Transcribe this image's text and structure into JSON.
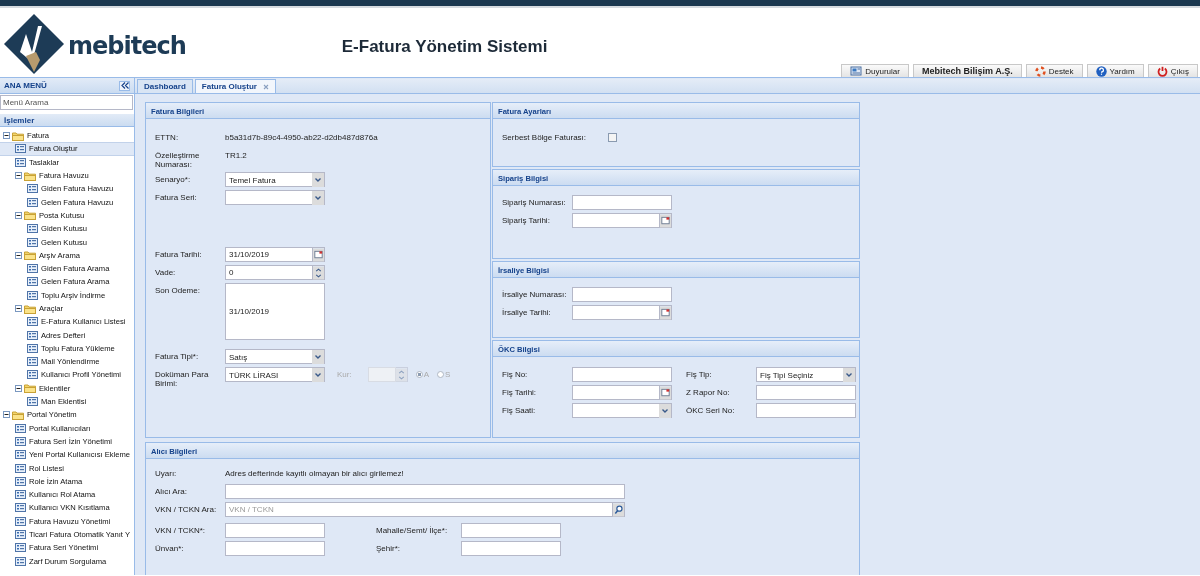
{
  "header": {
    "logo_text": "mebitech",
    "title": "E-Fatura Yönetim Sistemi",
    "buttons": [
      {
        "label": "Duyurular"
      },
      {
        "label": "Mebitech Bilişim A.Ş."
      },
      {
        "label": "Destek"
      },
      {
        "label": "Yardım"
      },
      {
        "label": "Çıkış"
      }
    ]
  },
  "sidebar": {
    "title": "ANA MENÜ",
    "search": {
      "placeholder": "Menü Arama"
    },
    "section": "İşlemler",
    "tree": [
      {
        "label": "Fatura",
        "kind": "folder",
        "expanded": true,
        "selected": false,
        "children": [
          {
            "label": "Fatura Oluştur",
            "kind": "page",
            "selected": true
          },
          {
            "label": "Taslaklar",
            "kind": "page",
            "selected": false
          },
          {
            "label": "Fatura Havuzu",
            "kind": "folder",
            "expanded": true,
            "selected": false,
            "children": [
              {
                "label": "Giden Fatura Havuzu",
                "kind": "page",
                "selected": false
              },
              {
                "label": "Gelen Fatura Havuzu",
                "kind": "page",
                "selected": false
              }
            ]
          },
          {
            "label": "Posta Kutusu",
            "kind": "folder",
            "expanded": true,
            "selected": false,
            "children": [
              {
                "label": "Giden Kutusu",
                "kind": "page",
                "selected": false
              },
              {
                "label": "Gelen Kutusu",
                "kind": "page",
                "selected": false
              }
            ]
          },
          {
            "label": "Arşiv Arama",
            "kind": "folder",
            "expanded": true,
            "selected": false,
            "children": [
              {
                "label": "Giden Fatura Arama",
                "kind": "page",
                "selected": false
              },
              {
                "label": "Gelen Fatura Arama",
                "kind": "page",
                "selected": false
              },
              {
                "label": "Toplu Arşiv İndirme",
                "kind": "page",
                "selected": false
              }
            ]
          },
          {
            "label": "Araçlar",
            "kind": "folder",
            "expanded": true,
            "selected": false,
            "children": [
              {
                "label": "E-Fatura Kullanıcı Listesi",
                "kind": "page",
                "selected": false
              },
              {
                "label": "Adres Defteri",
                "kind": "page",
                "selected": false
              },
              {
                "label": "Toplu Fatura Yükleme",
                "kind": "page",
                "selected": false
              },
              {
                "label": "Mail Yönlendirme",
                "kind": "page",
                "selected": false
              },
              {
                "label": "Kullanıcı Profil Yönetimi",
                "kind": "page",
                "selected": false
              }
            ]
          },
          {
            "label": "Eklentiler",
            "kind": "folder",
            "expanded": true,
            "selected": false,
            "children": [
              {
                "label": "Man Eklentisi",
                "kind": "page",
                "selected": false
              }
            ]
          }
        ]
      },
      {
        "label": "Portal Yönetim",
        "kind": "folder",
        "expanded": true,
        "selected": false,
        "children": [
          {
            "label": "Portal Kullanıcıları",
            "kind": "page",
            "selected": false
          },
          {
            "label": "Fatura Seri İzin Yönetimi",
            "kind": "page",
            "selected": false
          },
          {
            "label": "Yeni Portal Kullanıcısı Ekleme",
            "kind": "page",
            "selected": false
          },
          {
            "label": "Rol Listesi",
            "kind": "page",
            "selected": false
          },
          {
            "label": "Role İzin Atama",
            "kind": "page",
            "selected": false
          },
          {
            "label": "Kullanıcı Rol Atama",
            "kind": "page",
            "selected": false
          },
          {
            "label": "Kullanıcı VKN Kısıtlama",
            "kind": "page",
            "selected": false
          },
          {
            "label": "Fatura Havuzu Yönetimi",
            "kind": "page",
            "selected": false
          },
          {
            "label": "Ticari Fatura Otomatik Yanıt Y",
            "kind": "page",
            "selected": false
          },
          {
            "label": "Fatura Seri Yönetimi",
            "kind": "page",
            "selected": false
          },
          {
            "label": "Zarf Durum Sorgulama",
            "kind": "page",
            "selected": false
          }
        ]
      }
    ]
  },
  "tabs": [
    {
      "label": "Dashboard",
      "selected": false,
      "closable": false
    },
    {
      "label": "Fatura Oluştur",
      "selected": true,
      "closable": true
    }
  ],
  "fatura_bilgileri": {
    "title": "Fatura Bilgileri",
    "groups": [
      [
        {
          "label": "ETTN:",
          "kind": "text",
          "value": "b5a31d7b-89c4-4950-ab22-d2db487d876a"
        },
        {
          "label": "Özelleştirme Numarası:",
          "kind": "text",
          "value": "TR1.2"
        },
        {
          "label": "Senaryo*:",
          "kind": "select",
          "value": "Temel Fatura"
        },
        {
          "label": "Fatura Seri:",
          "kind": "select"
        }
      ],
      [
        {
          "label": "Fatura Tarihi:",
          "kind": "date",
          "value": "31/10/2019"
        },
        {
          "label": "Vade:",
          "kind": "spinner",
          "value": "0"
        },
        {
          "label": "Son Odeme:",
          "kind": "textarea",
          "value": "31/10/2019"
        },
        {
          "label": "Fatura Tipi*:",
          "kind": "select",
          "value": "Satış"
        },
        {
          "label": "Doküman Para Birimi:",
          "kind": "currency",
          "value": "TÜRK LİRASI",
          "rate_label": "Kur:",
          "rate_disabled": true,
          "options": [
            {
              "label": "A",
              "selected": true
            },
            {
              "label": "S",
              "selected": false
            }
          ]
        }
      ]
    ]
  },
  "fatura_ayarlari": {
    "title": "Fatura Ayarları",
    "fields": [
      {
        "label": "Serbest Bölge Faturası:",
        "kind": "checkbox",
        "checked": false
      }
    ]
  },
  "siparis_bilgisi": {
    "title": "Sipariş Bilgisi",
    "fields": [
      {
        "label": "Sipariş Numarası:",
        "kind": "input"
      },
      {
        "label": "Sipariş Tarihi:",
        "kind": "date"
      }
    ]
  },
  "irsaliye_bilgisi": {
    "title": "İrsaliye Bilgisi",
    "fields": [
      {
        "label": "İrsaliye Numarası:",
        "kind": "input"
      },
      {
        "label": "İrsaliye Tarihi:",
        "kind": "date"
      }
    ]
  },
  "okc_bilgisi": {
    "title": "ÖKC Bilgisi",
    "fields": [
      {
        "label": "Fiş No:",
        "kind": "input"
      },
      {
        "label": "Fiş Tip:",
        "kind": "select",
        "value": "Fiş Tipi Seçiniz"
      },
      {
        "label": "Fiş Tarihi:",
        "kind": "date"
      },
      {
        "label": "Z Rapor No:",
        "kind": "input"
      },
      {
        "label": "Fiş Saati:",
        "kind": "select"
      },
      {
        "label": "ÖKC Seri No:",
        "kind": "input"
      }
    ]
  },
  "alici_bilgileri": {
    "title": "Alıcı Bilgileri",
    "fields": [
      {
        "label": "Uyarı:",
        "kind": "text",
        "value": "Adres defterinde kayıtlı olmayan bir alıcı girilemez!"
      },
      {
        "label": "Alıcı Ara:",
        "kind": "input"
      },
      {
        "label": "VKN / TCKN Ara:",
        "kind": "search",
        "placeholder": "VKN / TCKN"
      }
    ],
    "columns": [
      [
        {
          "label": "VKN / TCKN*:",
          "kind": "input"
        },
        {
          "label": "Ünvan*:",
          "kind": "input"
        }
      ],
      [
        {
          "label": "Mahalle/Semt/ İlçe*:",
          "kind": "input"
        },
        {
          "label": "Şehir*:",
          "kind": "input"
        }
      ]
    ]
  }
}
